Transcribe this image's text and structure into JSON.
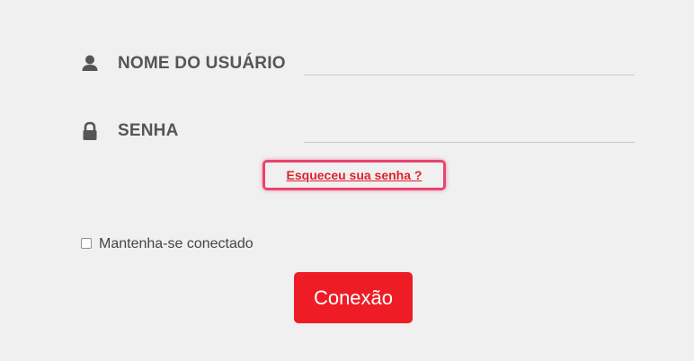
{
  "login_form": {
    "username": {
      "label": "NOME DO USUÁRIO",
      "value": "",
      "icon": "user-icon"
    },
    "password": {
      "label": "SENHA",
      "value": "",
      "icon": "lock-icon"
    },
    "forgot_password_link": "Esqueceu sua senha ?",
    "remember_me": {
      "label": "Mantenha-se conectado",
      "checked": false
    },
    "submit_label": "Conexão"
  },
  "colors": {
    "background": "#f0f0f0",
    "label_text": "#555555",
    "link": "#e0202c",
    "highlight_border": "#e8446e",
    "button": "#ee1c25",
    "button_text": "#ffffff"
  }
}
